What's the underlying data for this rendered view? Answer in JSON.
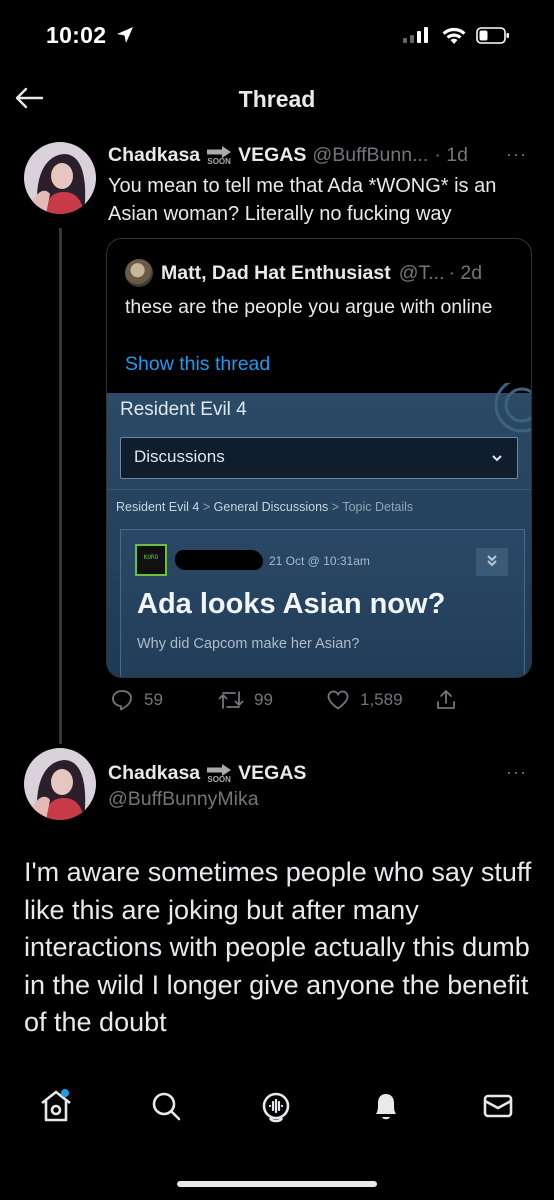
{
  "status_bar": {
    "time": "10:02"
  },
  "header": {
    "title": "Thread"
  },
  "tweet1": {
    "display_name": "Chadkasa",
    "name_suffix": "VEGAS",
    "soon_label": "SOON",
    "handle": "@BuffBunn...",
    "time": "· 1d",
    "more": "···",
    "text": "You mean to tell me that Ada *WONG* is an Asian woman? Literally no fucking way",
    "quote": {
      "display_name": "Matt, Dad Hat Enthusiast",
      "handle": "@T...",
      "time": "· 2d",
      "text": "these are the people you argue with online",
      "show_thread": "Show this thread",
      "image": {
        "game_title": "Resident Evil 4",
        "dropdown_value": "Discussions",
        "breadcrumb": [
          "Resident Evil 4",
          "General Discussions",
          "Topic Details"
        ],
        "avatar_label": "KURO",
        "post_date": "21 Oct @ 10:31am",
        "post_title": "Ada looks Asian now?",
        "post_subtitle": "Why did Capcom make her Asian?"
      }
    },
    "stats": {
      "replies": "59",
      "retweets": "99",
      "likes": "1,589"
    }
  },
  "tweet2": {
    "display_name": "Chadkasa",
    "name_suffix": "VEGAS",
    "soon_label": "SOON",
    "handle": "@BuffBunnyMika",
    "more": "···",
    "text": "I'm aware sometimes people who say stuff like this are joking but after many interactions with people actually this dumb in the wild I longer give anyone the benefit of the doubt"
  },
  "colors": {
    "accent": "#1d9bf0",
    "background": "#000000",
    "muted": "#71767b"
  },
  "tab_bar": [
    "home-icon",
    "search-icon",
    "spaces-icon",
    "notifications-icon",
    "messages-icon"
  ]
}
